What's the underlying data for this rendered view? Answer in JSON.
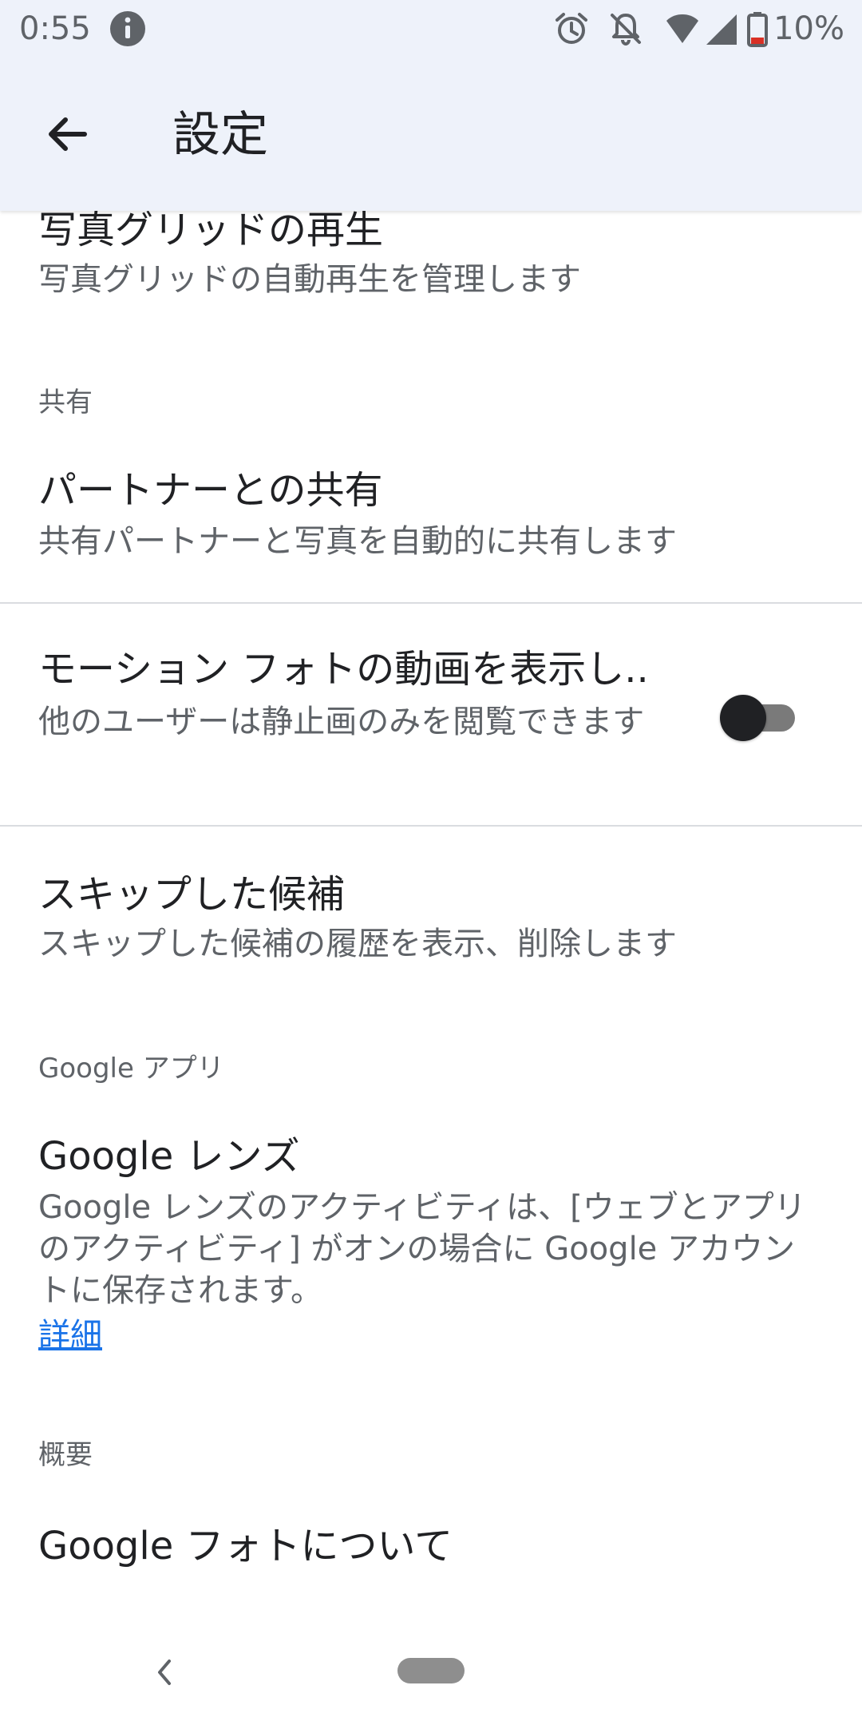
{
  "status_bar": {
    "time": "0:55",
    "battery": "10%"
  },
  "app_bar": {
    "title": "設定"
  },
  "items": {
    "photo_grid": {
      "title": "写真グリッドの再生",
      "summary": "写真グリッドの自動再生を管理します"
    },
    "partner_sharing": {
      "title": "パートナーとの共有",
      "summary": "共有パートナーと写真を自動的に共有します"
    },
    "motion_photos": {
      "title": "モーション フォトの動画を表示し..",
      "summary": "他のユーザーは静止画のみを閲覧できます",
      "enabled": false
    },
    "skipped_suggestions": {
      "title": "スキップした候補",
      "summary": "スキップした候補の履歴を表示、削除します"
    },
    "google_lens": {
      "title": "Google レンズ",
      "summary": "Google レンズのアクティビティは、[ウェブとアプリのアクティビティ] がオンの場合に Google アカウントに保存されます。",
      "link": "詳細"
    },
    "about": {
      "title": "Google フォトについて"
    }
  },
  "sections": {
    "sharing": "共有",
    "google_apps": "Google アプリ",
    "overview": "概要"
  },
  "colors": {
    "accent_link": "#1a73e8",
    "app_bar_bg": "#eef2fa"
  }
}
